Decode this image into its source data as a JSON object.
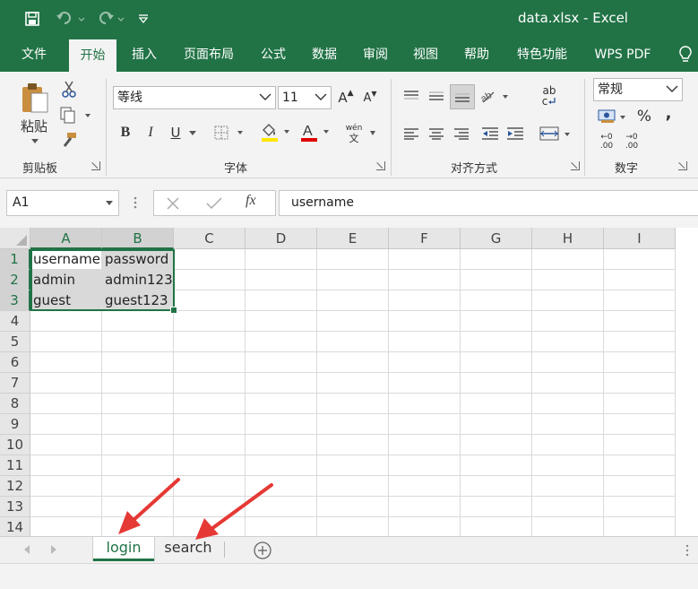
{
  "window": {
    "title": "data.xlsx  -  Excel"
  },
  "colors": {
    "brand": "#217346",
    "annotation_arrow": "#e53935",
    "font_color_bar": "#e00000",
    "highlight_bar": "#ffe600"
  },
  "quick_access": [
    "save-icon",
    "undo-icon",
    "redo-icon",
    "customize-icon"
  ],
  "tabs": [
    {
      "label": "文件",
      "active": false
    },
    {
      "label": "开始",
      "active": true
    },
    {
      "label": "插入",
      "active": false
    },
    {
      "label": "页面布局",
      "active": false
    },
    {
      "label": "公式",
      "active": false
    },
    {
      "label": "数据",
      "active": false
    },
    {
      "label": "审阅",
      "active": false
    },
    {
      "label": "视图",
      "active": false
    },
    {
      "label": "帮助",
      "active": false
    },
    {
      "label": "特色功能",
      "active": false
    },
    {
      "label": "WPS PDF",
      "active": false
    }
  ],
  "ribbon": {
    "clipboard": {
      "paste_label": "粘贴",
      "group_label": "剪贴板"
    },
    "font": {
      "font_name": "等线",
      "font_size": "11",
      "bold": "B",
      "italic": "I",
      "underline": "U",
      "increase": "A",
      "decrease": "A",
      "phonetic_top": "wén",
      "phonetic_bottom": "文",
      "font_color_glyph": "A",
      "group_label": "字体"
    },
    "alignment": {
      "group_label": "对齐方式",
      "wrap_top": "ab",
      "wrap_bottom": "c"
    },
    "number": {
      "format": "常规",
      "percent": "%",
      "comma": ",",
      "inc_decimal_top": "←0",
      "inc_decimal_bottom": ".00",
      "dec_decimal_top": "→0",
      "dec_decimal_bottom": ".00",
      "group_label": "数字"
    }
  },
  "formula_bar": {
    "name_box": "A1",
    "fx": "fx",
    "content": "username"
  },
  "grid": {
    "columns": [
      "A",
      "B",
      "C",
      "D",
      "E",
      "F",
      "G",
      "H",
      "I"
    ],
    "selected_columns": [
      "A",
      "B"
    ],
    "rows": [
      {
        "num": "1",
        "cells": [
          "username",
          "password"
        ]
      },
      {
        "num": "2",
        "cells": [
          "admin",
          "admin123"
        ]
      },
      {
        "num": "3",
        "cells": [
          "guest",
          "guest123"
        ]
      },
      {
        "num": "4",
        "cells": []
      },
      {
        "num": "5",
        "cells": []
      },
      {
        "num": "6",
        "cells": []
      },
      {
        "num": "7",
        "cells": []
      },
      {
        "num": "8",
        "cells": []
      },
      {
        "num": "9",
        "cells": []
      },
      {
        "num": "10",
        "cells": []
      },
      {
        "num": "11",
        "cells": []
      },
      {
        "num": "12",
        "cells": []
      },
      {
        "num": "13",
        "cells": []
      },
      {
        "num": "14",
        "cells": []
      }
    ],
    "selected_rows": 3
  },
  "sheets": [
    {
      "label": "login",
      "active": true
    },
    {
      "label": "search",
      "active": false
    }
  ]
}
